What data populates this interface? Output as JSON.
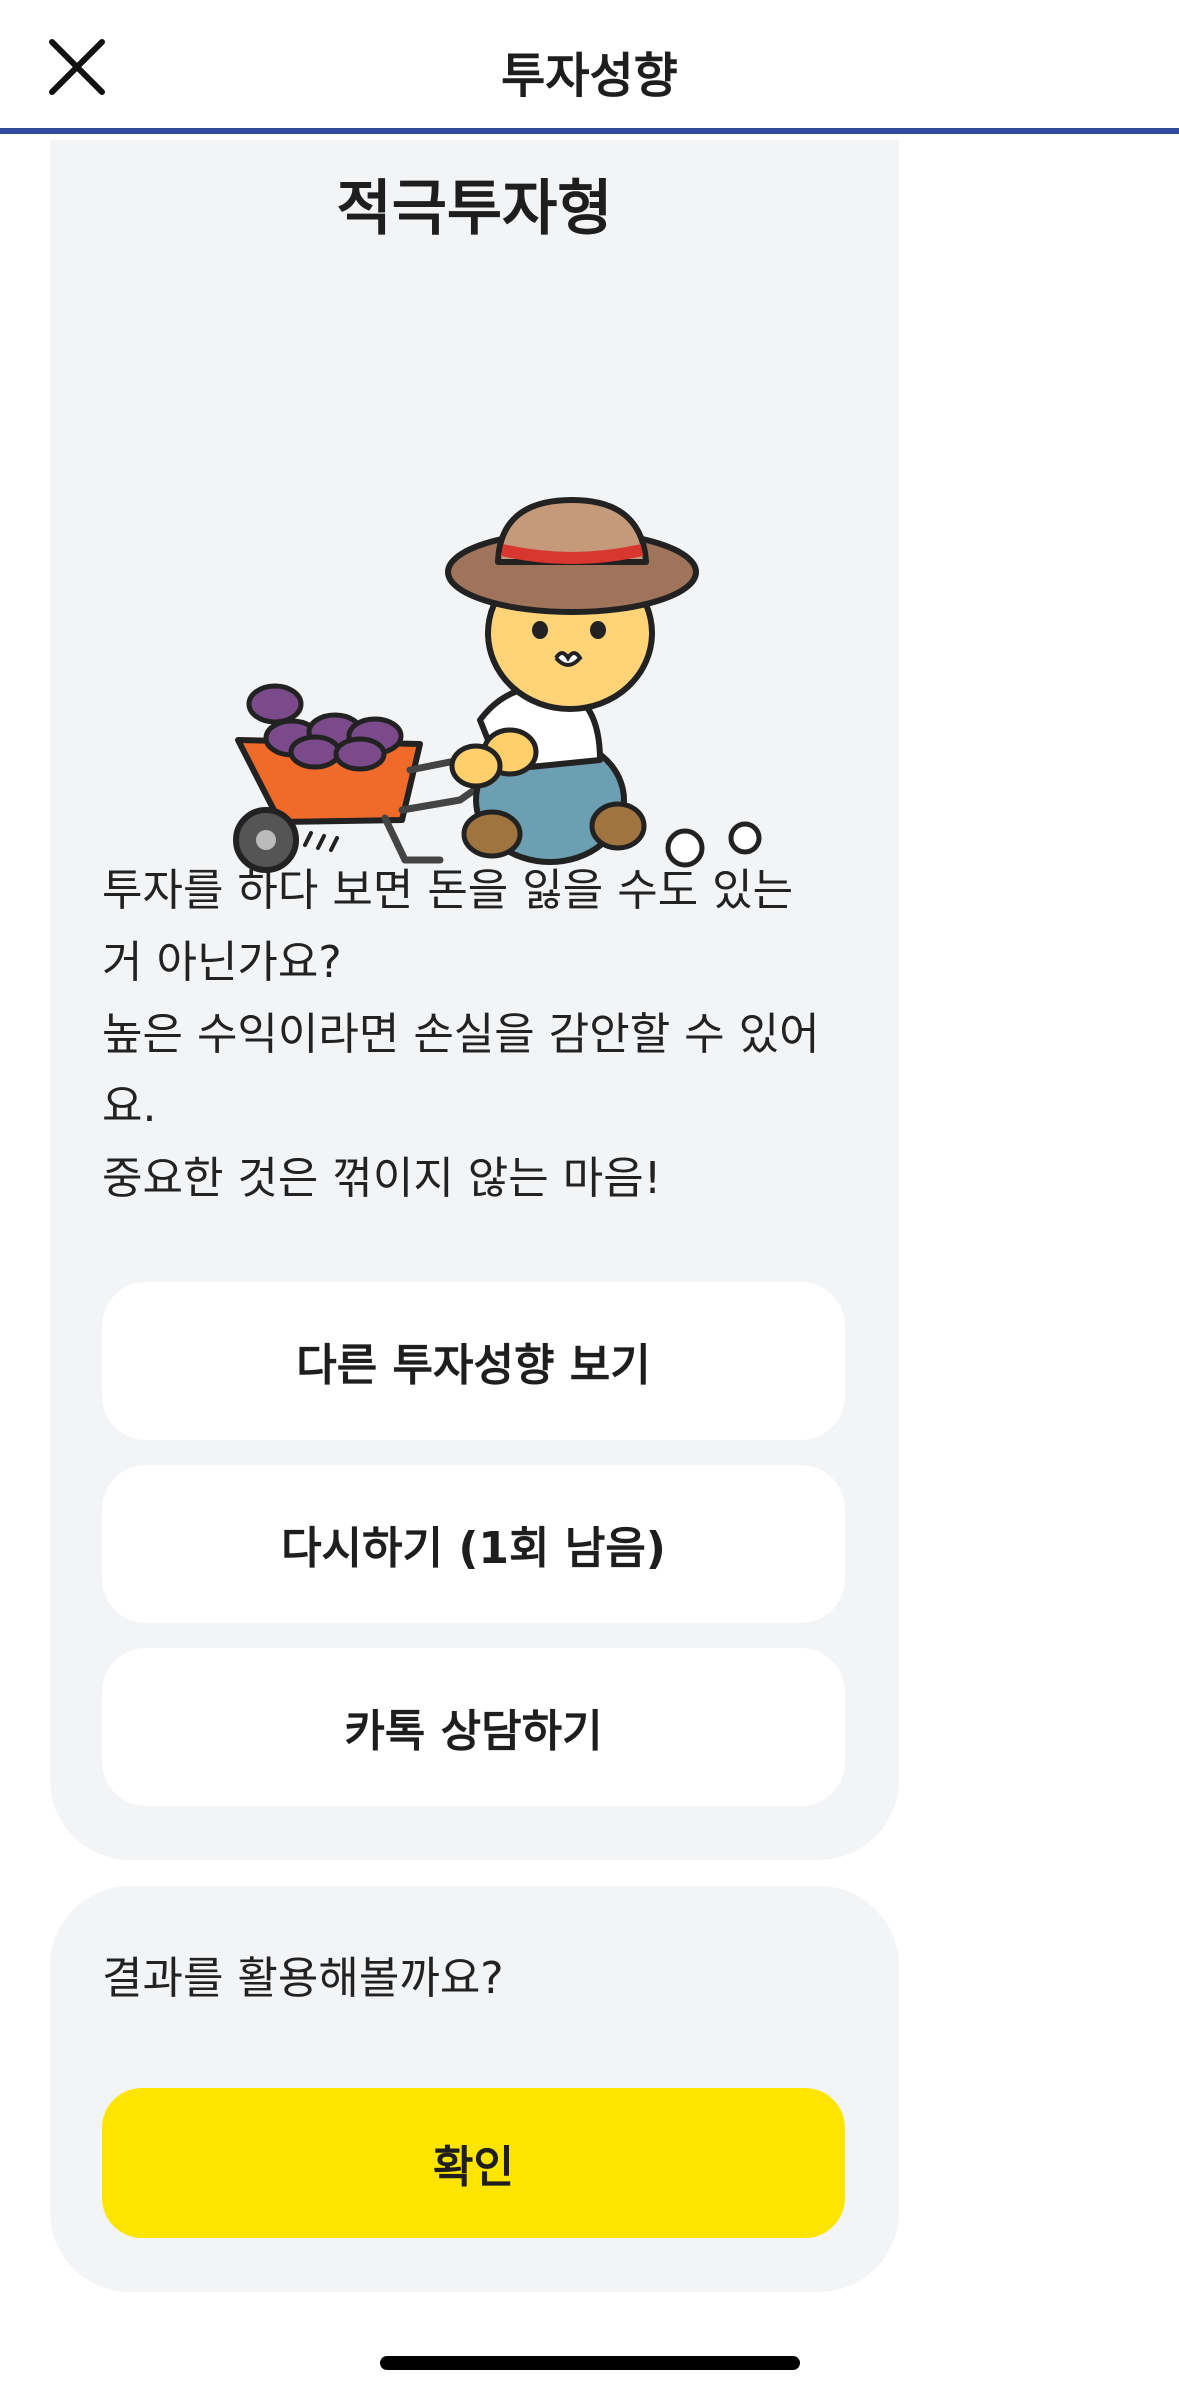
{
  "header": {
    "title": "투자성향",
    "close_icon": "close-icon"
  },
  "result": {
    "type_title": "적극투자형",
    "illustration": "ryan-wheelbarrow-sweet-potatoes",
    "description": "투자를 하다 보면 돈을 잃을 수도 있는\n거 아닌가요?\n높은 수익이라면 손실을 감안할 수 있어\n요.\n중요한 것은 꺾이지 않는 마음!",
    "buttons": {
      "other_types": "다른 투자성향 보기",
      "retry": "다시하기 (1회 남음)",
      "kakao_consult": "카톡 상담하기"
    }
  },
  "bottom": {
    "question": "결과를 활용해볼까요?",
    "confirm": "확인"
  },
  "colors": {
    "header_underline": "#2f4a9a",
    "card_bg": "#f3f4f6",
    "confirm_bg": "#fee500"
  }
}
